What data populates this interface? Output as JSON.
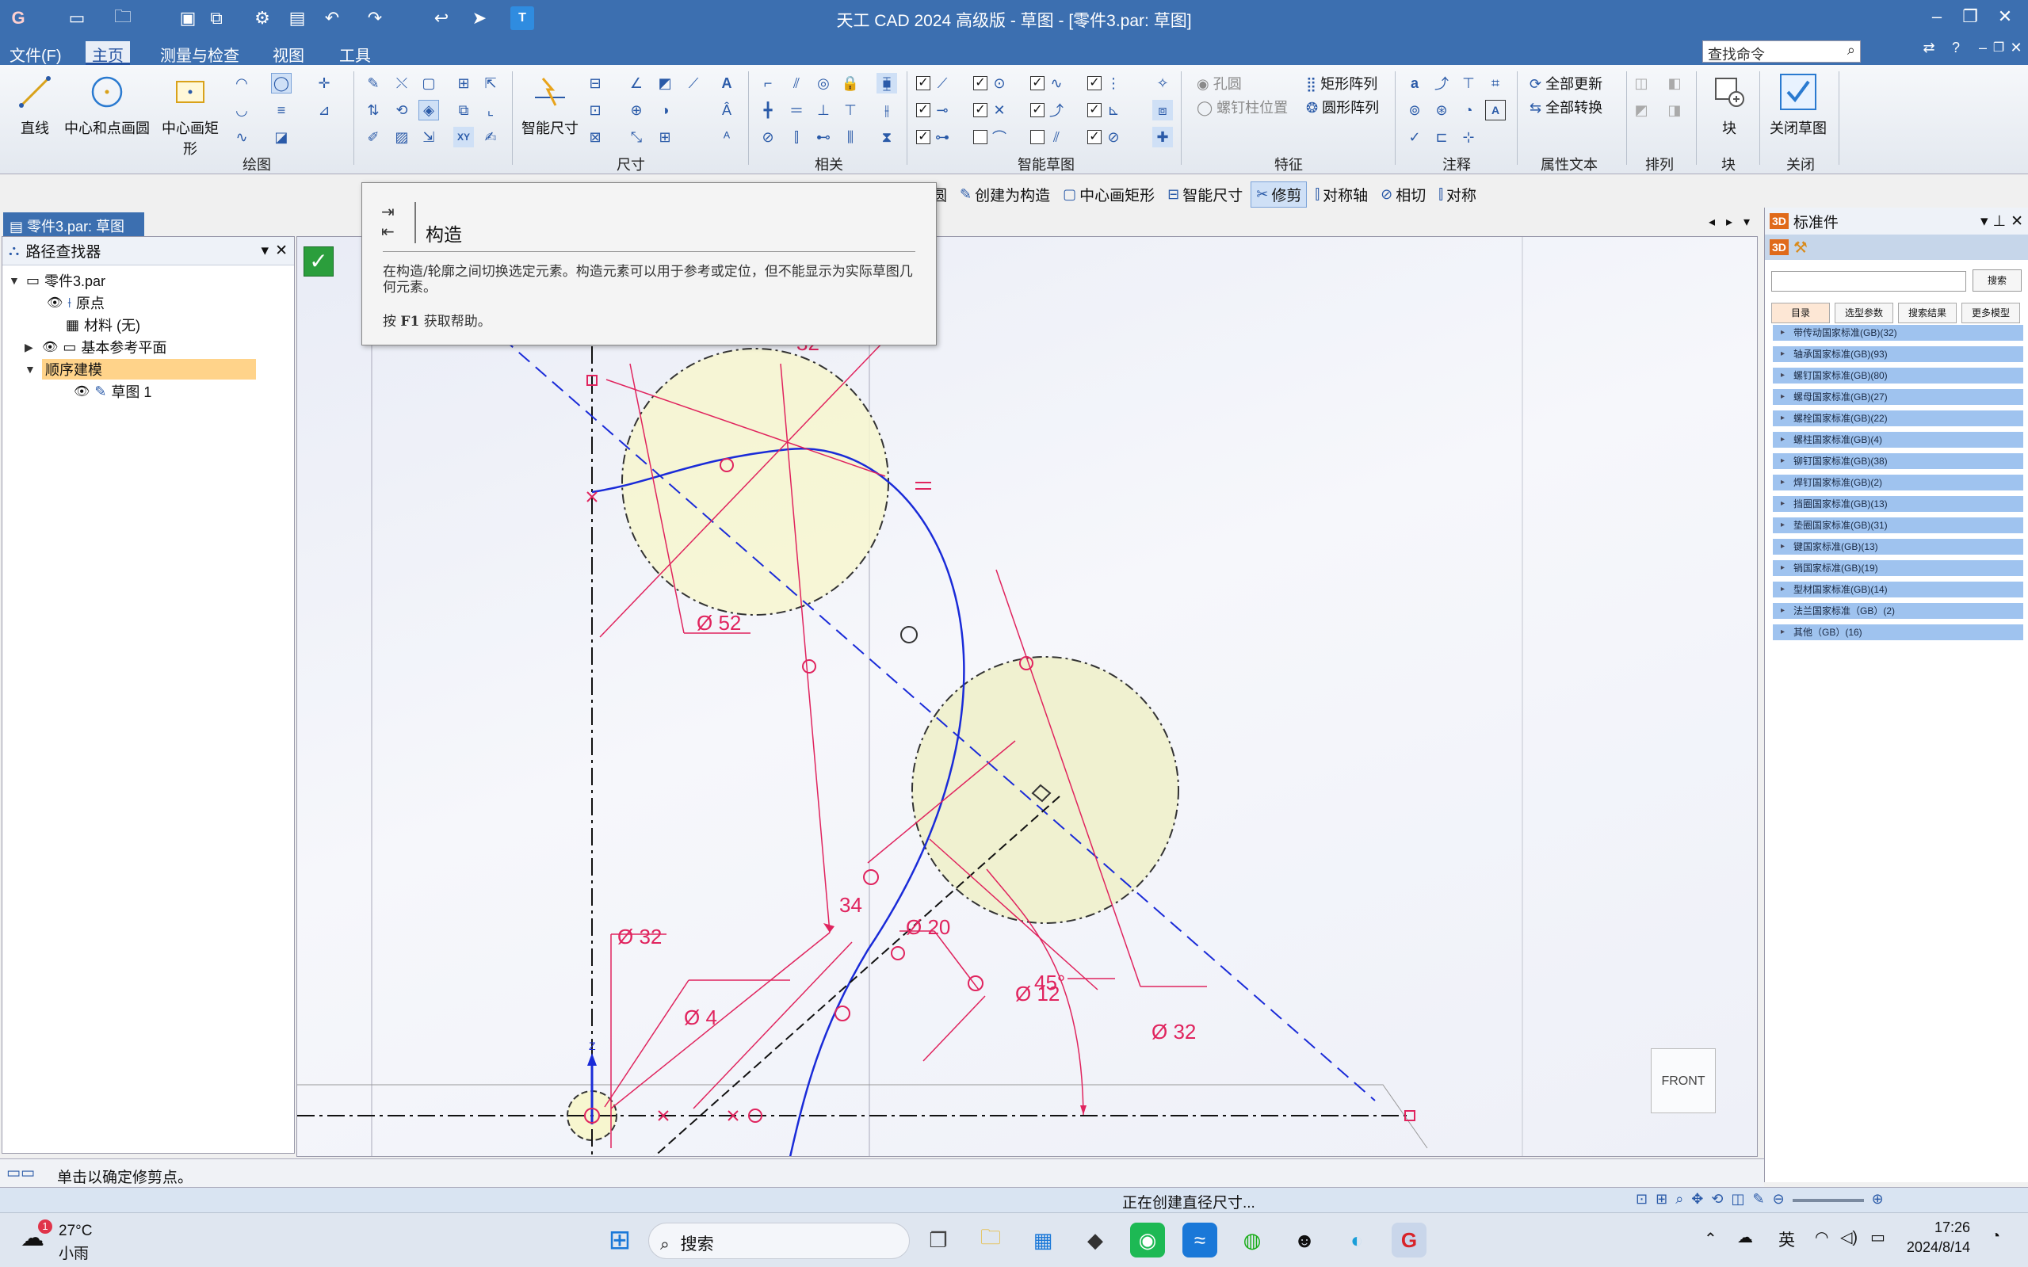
{
  "app": {
    "title": "天工 CAD 2024 高级版 - 草图 - [零件3.par: 草图]",
    "logo": "G",
    "win_controls": [
      "–",
      "❐",
      "✕"
    ],
    "aux_controls": [
      "⇄",
      "?",
      "–",
      "❐",
      "✕"
    ]
  },
  "menu": {
    "items": [
      "文件(F)",
      "主页",
      "测量与检查",
      "视图",
      "工具"
    ],
    "search_placeholder": "查找命令"
  },
  "ribbon": {
    "draw": {
      "line": "直线",
      "center_circle": "中心和点画圆",
      "center_rect": "中心画矩形",
      "label": "绘图"
    },
    "dimension": {
      "smart_dim": "智能尺寸",
      "label": "尺寸"
    },
    "relate": {
      "label": "相关"
    },
    "smart_sketch": {
      "label": "智能草图"
    },
    "feature": {
      "hole": "孔圆",
      "stud_pos": "螺钉柱位置",
      "rect_pattern": "矩形阵列",
      "circ_pattern": "圆形阵列",
      "label": "特征"
    },
    "annotation": {
      "label": "注释"
    },
    "property_text": {
      "update_all": "全部更新",
      "convert_all": "全部转换",
      "label": "属性文本"
    },
    "arrange": {
      "label": "排列"
    },
    "block": {
      "name": "块",
      "label": "块"
    },
    "close": {
      "name": "关闭草图",
      "label": "关闭"
    }
  },
  "cmdbar": {
    "items": [
      "圆",
      "创建为构造",
      "中心画矩形",
      "智能尺寸",
      "修剪",
      "对称轴",
      "相切",
      "对称"
    ],
    "active": "修剪"
  },
  "doctab": {
    "label": "零件3.par: 草图"
  },
  "pathfinder": {
    "title": "路径查找器",
    "items": [
      {
        "label": "零件3.par"
      },
      {
        "label": "原点"
      },
      {
        "label": "材料 (无)"
      },
      {
        "label": "基本参考平面"
      },
      {
        "label": "顺序建模"
      },
      {
        "label": "草图 1"
      }
    ]
  },
  "tooltip": {
    "title": "构造",
    "body": "在构造/轮廓之间切换选定元素。构造元素可以用于参考或定位，但不能显示为实际草图几何元素。",
    "help_prefix": "按",
    "help_key": "F1",
    "help_suffix": "获取帮助。"
  },
  "sketch": {
    "dims": [
      "Ø 52",
      "Ø 32",
      "Ø 4",
      "Ø 20",
      "Ø 12",
      "Ø 32",
      "34",
      "45°",
      "32"
    ],
    "axis_z": "Z",
    "view": "FRONT"
  },
  "stdparts": {
    "title": "标准件",
    "search_btn": "搜索",
    "tabs": [
      "目录",
      "选型参数",
      "搜索结果",
      "更多模型"
    ],
    "libraries": [
      "带传动国家标准(GB)(32)",
      "轴承国家标准(GB)(93)",
      "螺钉国家标准(GB)(80)",
      "螺母国家标准(GB)(27)",
      "螺栓国家标准(GB)(22)",
      "螺柱国家标准(GB)(4)",
      "铆钉国家标准(GB)(38)",
      "焊钉国家标准(GB)(2)",
      "挡圈国家标准(GB)(13)",
      "垫圈国家标准(GB)(31)",
      "键国家标准(GB)(13)",
      "销国家标准(GB)(19)",
      "型材国家标准(GB)(14)",
      "法兰国家标准（GB）(2)",
      "其他（GB）(16)"
    ]
  },
  "status": {
    "prompt": "单击以确定修剪点。",
    "progress": "正在创建直径尺寸..."
  },
  "taskbar": {
    "weather_temp": "27°C",
    "weather_desc": "小雨",
    "weather_badge": "1",
    "search": "搜索",
    "ime": "英",
    "time": "17:26",
    "date": "2024/8/14"
  },
  "colors": {
    "titlebar": "#3c6fb0",
    "sketch_red": "#e0245e",
    "sketch_blue": "#1a2bd8",
    "circle_fill": "#f7f6cf",
    "accept_green": "#2b9e3c"
  }
}
